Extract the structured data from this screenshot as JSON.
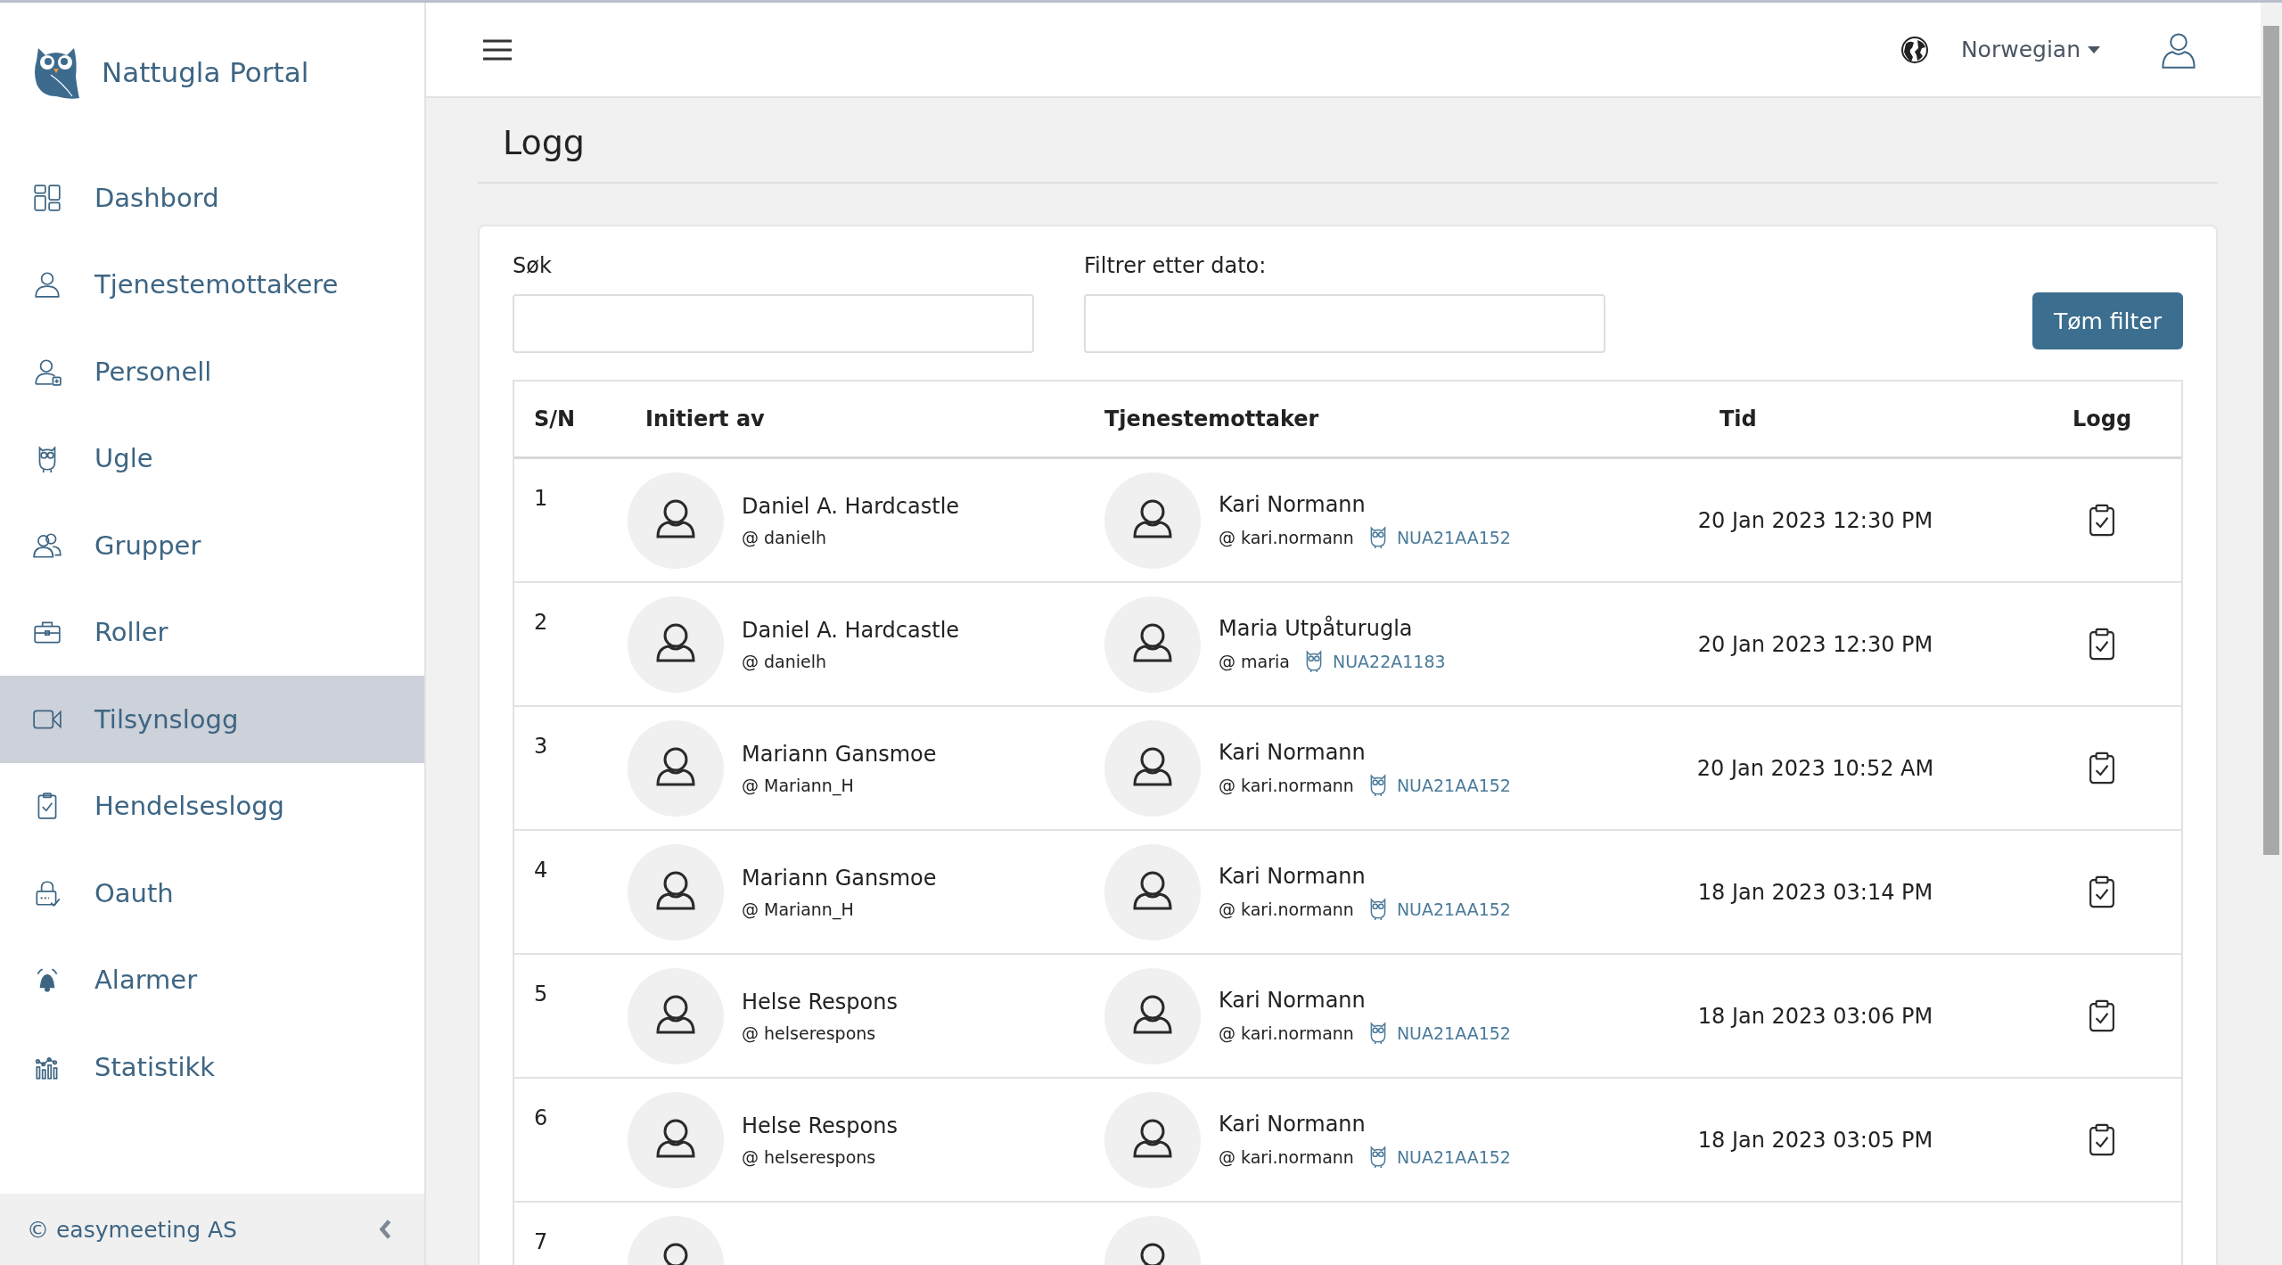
{
  "sidebar": {
    "brand": "Nattugla Portal",
    "items": [
      {
        "label": "Dashbord",
        "selected": false
      },
      {
        "label": "Tjenestemottakere",
        "selected": false
      },
      {
        "label": "Personell",
        "selected": false
      },
      {
        "label": "Ugle",
        "selected": false
      },
      {
        "label": "Grupper",
        "selected": false
      },
      {
        "label": "Roller",
        "selected": false
      },
      {
        "label": "Tilsynslogg",
        "selected": true
      },
      {
        "label": "Hendelseslogg",
        "selected": false
      },
      {
        "label": "Oauth",
        "selected": false
      },
      {
        "label": "Alarmer",
        "selected": false
      },
      {
        "label": "Statistikk",
        "selected": false
      }
    ],
    "footer": "© easymeeting AS"
  },
  "header": {
    "language": "Norwegian"
  },
  "page": {
    "title": "Logg"
  },
  "filters": {
    "search_label": "Søk",
    "date_label": "Filtrer etter dato:",
    "clear_button": "Tøm filter"
  },
  "table": {
    "columns": [
      "S/N",
      "Initiert av",
      "Tjenestemottaker",
      "Tid",
      "Logg"
    ],
    "rows": [
      {
        "sn": "1",
        "initiator": {
          "name": "Daniel A. Hardcastle",
          "username": "@ danielh"
        },
        "recipient": {
          "name": "Kari Normann",
          "username": "@ kari.normann",
          "device": "NUA21AA152"
        },
        "time": "20 Jan 2023 12:30 PM"
      },
      {
        "sn": "2",
        "initiator": {
          "name": "Daniel A. Hardcastle",
          "username": "@ danielh"
        },
        "recipient": {
          "name": "Maria Utpåturugla",
          "username": "@ maria",
          "device": "NUA22A1183"
        },
        "time": "20 Jan 2023 12:30 PM"
      },
      {
        "sn": "3",
        "initiator": {
          "name": "Mariann Gansmoe",
          "username": "@ Mariann_H"
        },
        "recipient": {
          "name": "Kari Normann",
          "username": "@ kari.normann",
          "device": "NUA21AA152"
        },
        "time": "20 Jan 2023 10:52 AM"
      },
      {
        "sn": "4",
        "initiator": {
          "name": "Mariann Gansmoe",
          "username": "@ Mariann_H"
        },
        "recipient": {
          "name": "Kari Normann",
          "username": "@ kari.normann",
          "device": "NUA21AA152"
        },
        "time": "18 Jan 2023 03:14 PM"
      },
      {
        "sn": "5",
        "initiator": {
          "name": "Helse Respons",
          "username": "@ helserespons"
        },
        "recipient": {
          "name": "Kari Normann",
          "username": "@ kari.normann",
          "device": "NUA21AA152"
        },
        "time": "18 Jan 2023 03:06 PM"
      },
      {
        "sn": "6",
        "initiator": {
          "name": "Helse Respons",
          "username": "@ helserespons"
        },
        "recipient": {
          "name": "Kari Normann",
          "username": "@ kari.normann",
          "device": "NUA21AA152"
        },
        "time": "18 Jan 2023 03:05 PM"
      },
      {
        "sn": "7"
      }
    ]
  }
}
